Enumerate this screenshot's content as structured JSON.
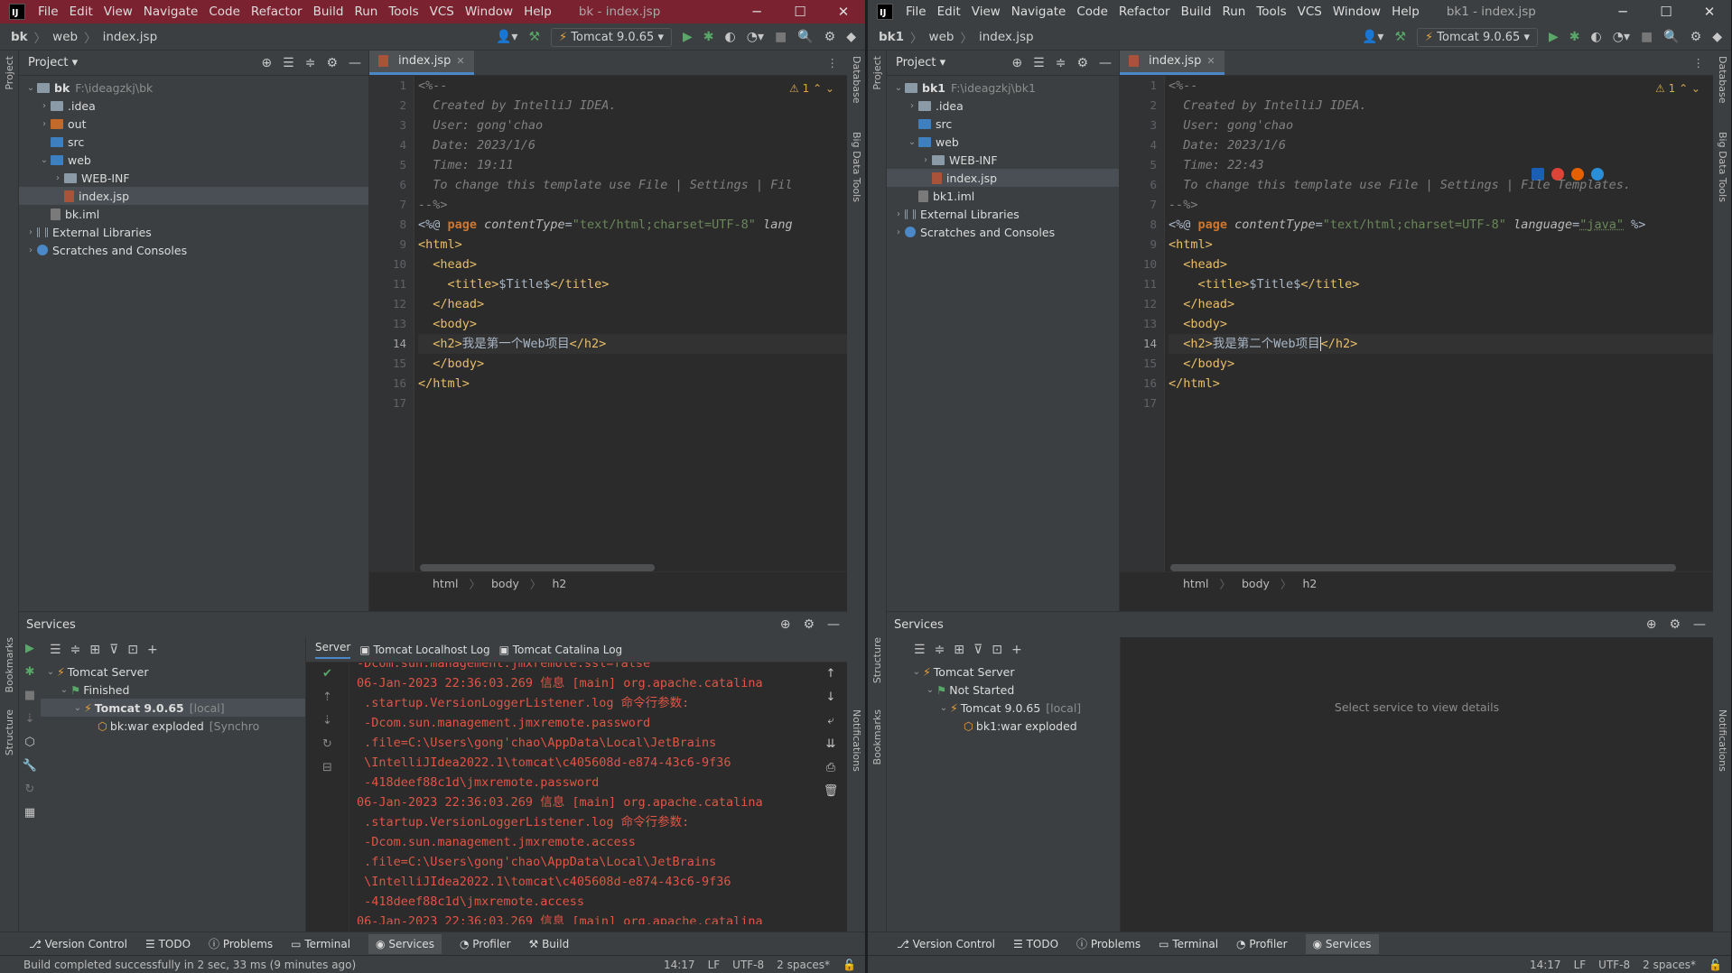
{
  "left": {
    "window_title": "bk - index.jsp",
    "menu": [
      "File",
      "Edit",
      "View",
      "Navigate",
      "Code",
      "Refactor",
      "Build",
      "Run",
      "Tools",
      "VCS",
      "Window",
      "Help"
    ],
    "breadcrumbs": [
      "bk",
      "web",
      "index.jsp"
    ],
    "run_config": "Tomcat 9.0.65",
    "project_panel": {
      "title": "Project",
      "tree": [
        {
          "label": "bk",
          "path": "F:\\ideagzkj\\bk",
          "level": 0,
          "chev": "v",
          "icon": "dir"
        },
        {
          "label": ".idea",
          "level": 1,
          "chev": ">",
          "icon": "dir"
        },
        {
          "label": "out",
          "level": 1,
          "chev": ">",
          "icon": "orng"
        },
        {
          "label": "src",
          "level": 1,
          "chev": "",
          "icon": "blu"
        },
        {
          "label": "web",
          "level": 1,
          "chev": "v",
          "icon": "blu"
        },
        {
          "label": "WEB-INF",
          "level": 2,
          "chev": ">",
          "icon": "dir"
        },
        {
          "label": "index.jsp",
          "level": 2,
          "chev": "",
          "icon": "file",
          "selected": true
        },
        {
          "label": "bk.iml",
          "level": 1,
          "chev": "",
          "icon": "iml"
        },
        {
          "label": "External Libraries",
          "level": 0,
          "chev": ">",
          "icon": "lib"
        },
        {
          "label": "Scratches and Consoles",
          "level": 0,
          "chev": ">",
          "icon": "scr"
        }
      ]
    },
    "editor": {
      "tab": "index.jsp",
      "warnings": "1",
      "current_line": 14,
      "line_numbers": [
        "1",
        "2",
        "3",
        "4",
        "5",
        "6",
        "7",
        "8",
        "9",
        "10",
        "11",
        "12",
        "13",
        "14",
        "15",
        "16",
        "17"
      ],
      "created_by": "Created by IntelliJ IDEA.",
      "user": "User: gong'chao",
      "date": "Date: 2023/1/6",
      "time": "Time: 19:11",
      "template_note": "To change this template use File | Settings | Fil",
      "page_directive": "page",
      "content_type_attr": "contentType",
      "content_type_val": "\"text/html;charset=UTF-8\"",
      "lang_attr": "lang",
      "lang_val": "",
      "title_text": "$Title$",
      "h2_text": "我是第一个Web项目",
      "breadcrumb": [
        "html",
        "body",
        "h2"
      ]
    },
    "services": {
      "title": "Services",
      "tree": [
        {
          "label": "Tomcat Server",
          "level": 0,
          "chev": "v"
        },
        {
          "label": "Finished",
          "level": 1,
          "chev": "v"
        },
        {
          "label": "Tomcat 9.0.65",
          "suffix": "[local]",
          "level": 2,
          "chev": "v",
          "bold": true,
          "selected": true
        },
        {
          "label": "bk:war exploded",
          "suffix": "[Synchro",
          "level": 3,
          "chev": ""
        }
      ],
      "log_tabs": [
        "Server",
        "Tomcat Localhost Log",
        "Tomcat Catalina Log"
      ],
      "log_lines": [
        "-Dcom.sun.management.jmxremote.ssl=false",
        "06-Jan-2023 22:36:03.269 信息 [main] org.apache.catalina",
        " .startup.VersionLoggerListener.log 命令行参数:",
        " -Dcom.sun.management.jmxremote.password",
        " .file=C:\\Users\\gong'chao\\AppData\\Local\\JetBrains",
        " \\IntelliJIdea2022.1\\tomcat\\c405608d-e874-43c6-9f36",
        " -418deef88c1d\\jmxremote.password",
        "06-Jan-2023 22:36:03.269 信息 [main] org.apache.catalina",
        " .startup.VersionLoggerListener.log 命令行参数:",
        " -Dcom.sun.management.jmxremote.access",
        " .file=C:\\Users\\gong'chao\\AppData\\Local\\JetBrains",
        " \\IntelliJIdea2022.1\\tomcat\\c405608d-e874-43c6-9f36",
        " -418deef88c1d\\jmxremote.access",
        "06-Jan-2023 22:36:03.269 信息 [main] org.apache.catalina"
      ]
    },
    "bottom_tabs": [
      "Version Control",
      "TODO",
      "Problems",
      "Terminal",
      "Services",
      "Profiler",
      "Build"
    ],
    "active_bottom_tab": "Services",
    "status": {
      "message": "Build completed successfully in 2 sec, 33 ms (9 minutes ago)",
      "position": "14:17",
      "line_sep": "LF",
      "encoding": "UTF-8",
      "indent": "2 spaces*"
    },
    "left_strip": [
      "Project",
      "Bookmarks",
      "Structure"
    ],
    "right_strip": [
      "Database",
      "Big Data Tools",
      "Notifications"
    ]
  },
  "right": {
    "window_title": "bk1 - index.jsp",
    "menu": [
      "File",
      "Edit",
      "View",
      "Navigate",
      "Code",
      "Refactor",
      "Build",
      "Run",
      "Tools",
      "VCS",
      "Window",
      "Help"
    ],
    "breadcrumbs": [
      "bk1",
      "web",
      "index.jsp"
    ],
    "run_config": "Tomcat 9.0.65",
    "project_panel": {
      "title": "Project",
      "tree": [
        {
          "label": "bk1",
          "path": "F:\\ideagzkj\\bk1",
          "level": 0,
          "chev": "v",
          "icon": "dir"
        },
        {
          "label": ".idea",
          "level": 1,
          "chev": ">",
          "icon": "dir"
        },
        {
          "label": "src",
          "level": 1,
          "chev": "",
          "icon": "blu"
        },
        {
          "label": "web",
          "level": 1,
          "chev": "v",
          "icon": "blu"
        },
        {
          "label": "WEB-INF",
          "level": 2,
          "chev": ">",
          "icon": "dir"
        },
        {
          "label": "index.jsp",
          "level": 2,
          "chev": "",
          "icon": "file",
          "selected": true
        },
        {
          "label": "bk1.iml",
          "level": 1,
          "chev": "",
          "icon": "iml"
        },
        {
          "label": "External Libraries",
          "level": 0,
          "chev": ">",
          "icon": "lib"
        },
        {
          "label": "Scratches and Consoles",
          "level": 0,
          "chev": ">",
          "icon": "scr"
        }
      ]
    },
    "editor": {
      "tab": "index.jsp",
      "warnings": "1",
      "current_line": 14,
      "line_numbers": [
        "1",
        "2",
        "3",
        "4",
        "5",
        "6",
        "7",
        "8",
        "9",
        "10",
        "11",
        "12",
        "13",
        "14",
        "15",
        "16",
        "17"
      ],
      "created_by": "Created by IntelliJ IDEA.",
      "user": "User: gong'chao",
      "date": "Date: 2023/1/6",
      "time": "Time: 22:43",
      "template_note": "To change this template use File | Settings | File Templates.",
      "page_directive": "page",
      "content_type_attr": "contentType",
      "content_type_val": "\"text/html;charset=UTF-8\"",
      "lang_attr": "language",
      "lang_val": "\"java\"",
      "title_text": "$Title$",
      "h2_text": "我是第二个Web项目",
      "breadcrumb": [
        "html",
        "body",
        "h2"
      ]
    },
    "services": {
      "title": "Services",
      "tree": [
        {
          "label": "Tomcat Server",
          "level": 0,
          "chev": "v"
        },
        {
          "label": "Not Started",
          "level": 1,
          "chev": "v"
        },
        {
          "label": "Tomcat 9.0.65",
          "suffix": "[local]",
          "level": 2,
          "chev": "v"
        },
        {
          "label": "bk1:war exploded",
          "level": 3,
          "chev": ""
        }
      ],
      "hint": "Select service to view details"
    },
    "bottom_tabs": [
      "Version Control",
      "TODO",
      "Problems",
      "Terminal",
      "Profiler",
      "Services"
    ],
    "active_bottom_tab": "Services",
    "status": {
      "position": "14:17",
      "line_sep": "LF",
      "encoding": "UTF-8",
      "indent": "2 spaces*"
    },
    "left_strip": [
      "Project",
      "Structure",
      "Bookmarks"
    ],
    "right_strip": [
      "Database",
      "Big Data Tools",
      "Notifications"
    ]
  }
}
